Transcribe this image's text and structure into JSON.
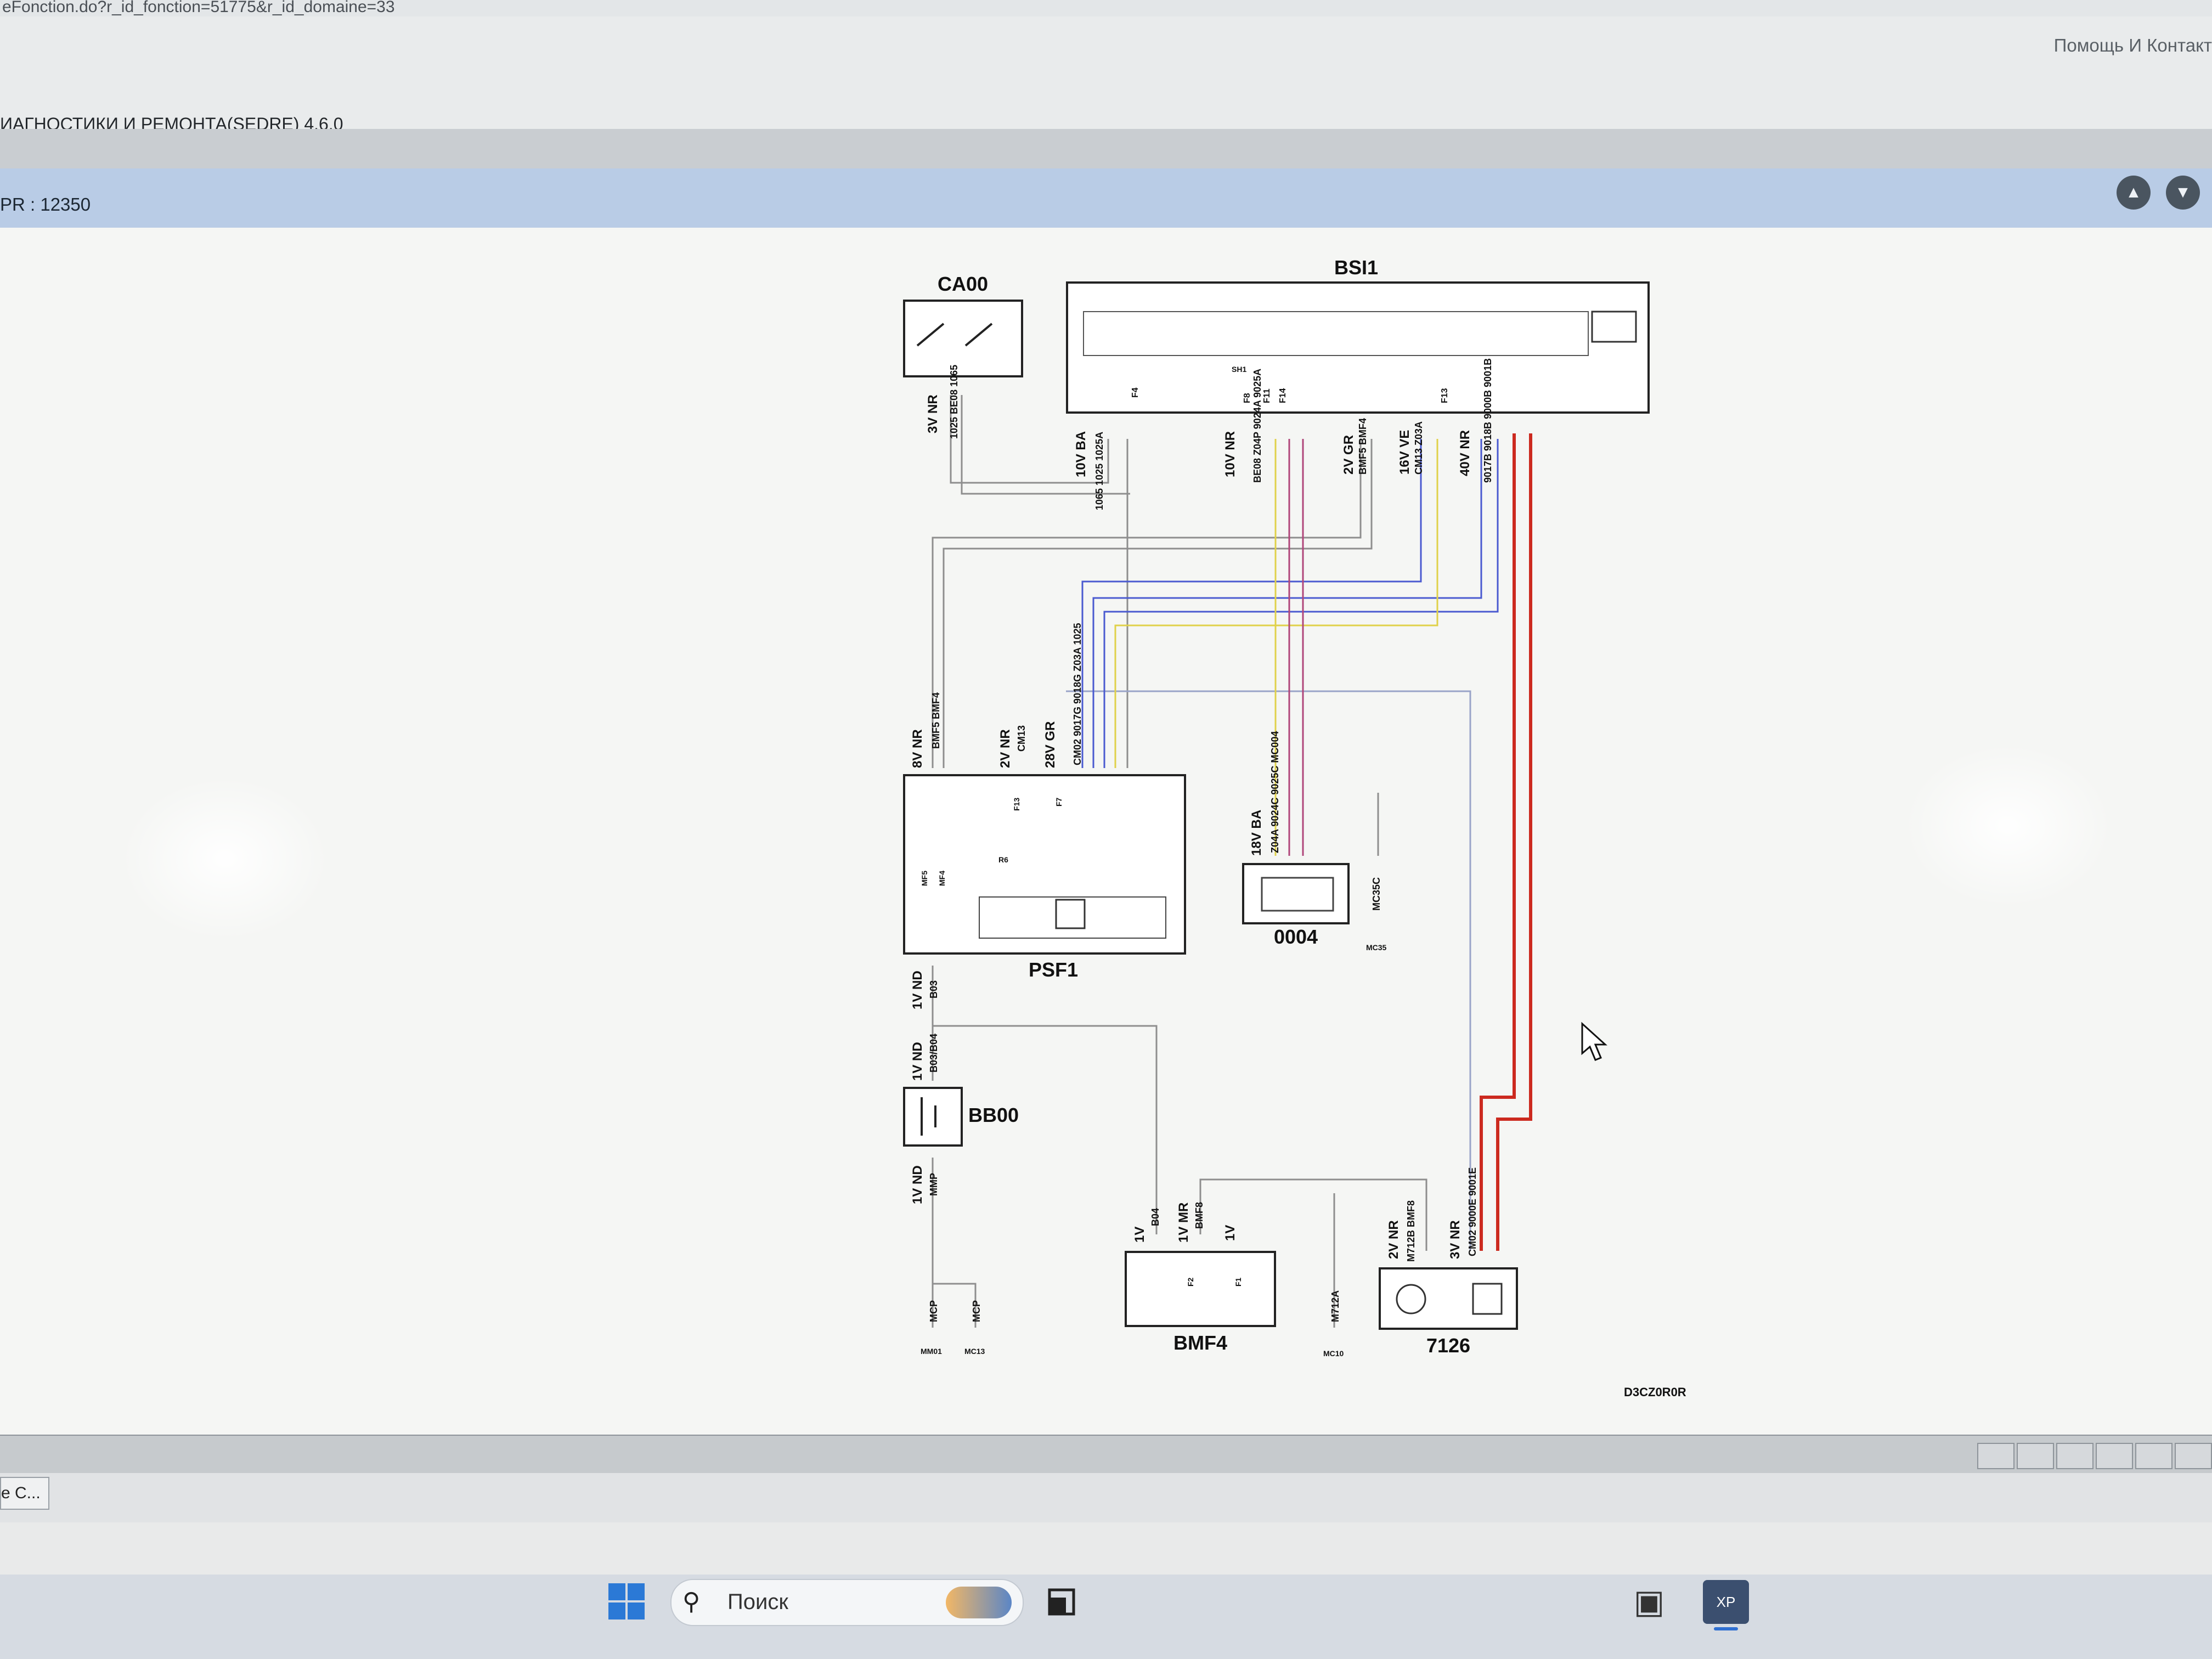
{
  "browser": {
    "url_fragment": "eFonction.do?r_id_fonction=51775&r_id_domaine=33"
  },
  "header": {
    "help_links": "Помощь И Контакт",
    "app_title": "ИАГНОСТИКИ И РЕМОНТА(SEDRE) 4.6.0"
  },
  "pr_bar": {
    "pr_label": "PR : 12350",
    "nav_up_icon": "up-arrow-icon",
    "nav_down_icon": "down-arrow-icon"
  },
  "diagram": {
    "components": {
      "ca00": "CA00",
      "bsi1": "BSI1",
      "psf1": "PSF1",
      "c0004": "0004",
      "bb00": "BB00",
      "bmf4": "BMF4",
      "c7126": "7126"
    },
    "reference_code": "D3CZ0R0R",
    "connectors": {
      "ca00_conn": "3V NR",
      "bsi_10vba": "10V BA",
      "bsi_10vnr": "10V NR",
      "bsi_2vgr": "2V GR",
      "bsi_16vve": "16V VE",
      "bsi_40vnr": "40V NR",
      "psf_8vnr": "8V NR",
      "psf_2vnr": "2V NR",
      "psf_28vgr": "28V GR",
      "c0004_18vba": "18V BA",
      "psf_1vnd": "1V ND",
      "bb00_top": "1V ND",
      "bb00_bottom": "1V ND",
      "bmf4_1v": "1V",
      "bmf4_1vmr": "1V MR",
      "bmf4_1v_b": "1V",
      "c7126_2vnr": "2V NR",
      "c7126_3vnr": "3V NR"
    },
    "wires": {
      "ca00_wires": "1025 BE08 1065",
      "bsi_10vba_wires": "1065 1025 1025A",
      "bsi_10vnr_wires": "BE08 Z04P 9024A 9025A",
      "bsi_2vgr_wires": "BMF5 BMF4",
      "bsi_16vve_wires": "CM13 Z03A",
      "bsi_40vnr_wires": "9017B 9018B 9000B 9001B",
      "psf_8vnr_wires": "BMF5 BMF4",
      "psf_2vnr_wires": "CM13",
      "psf_28vgr_wires": "CM02 9017G 9018G Z03A 1025",
      "c0004_wires": "Z04A 9024C 9025C MC004",
      "c0004_ground": "MC35C",
      "c0004_ground_point": "MC35",
      "psf_1vnd_wire": "B03",
      "bb00_top_wire": "B03/B04",
      "bb00_bottom_wire": "MMP",
      "ground_mcp_1": "MCP",
      "ground_mcp_2": "MCP",
      "ground_mm01": "MM01",
      "ground_mc13": "MC13",
      "bmf4_wire_b04": "B04",
      "bmf4_wire_bmf8": "BMF8",
      "ground_m712a": "M712A",
      "ground_mc10": "MC10",
      "c7126_2vnr_wires": "M712B BMF8",
      "c7126_3vnr_wires": "CM02 9000E 9001E"
    },
    "internal_labels": {
      "fuse_f4": "F4",
      "fuse_f8": "F8",
      "fuse_f11": "F11",
      "fuse_f14": "F14",
      "fuse_f13": "F13",
      "psf_f13": "F13",
      "psf_f7": "F7",
      "psf_mf5": "MF5",
      "psf_mf4": "MF4",
      "psf_r6": "R6",
      "bmf4_f2": "F2",
      "bmf4_f1": "F1",
      "bsi_sh1": "SH1"
    }
  },
  "status": {
    "task_label": "e C..."
  },
  "taskbar": {
    "search_placeholder": "Поиск",
    "start_icon": "windows-start-icon",
    "search_icon": "search-icon",
    "taskview_icon": "task-view-icon"
  }
}
